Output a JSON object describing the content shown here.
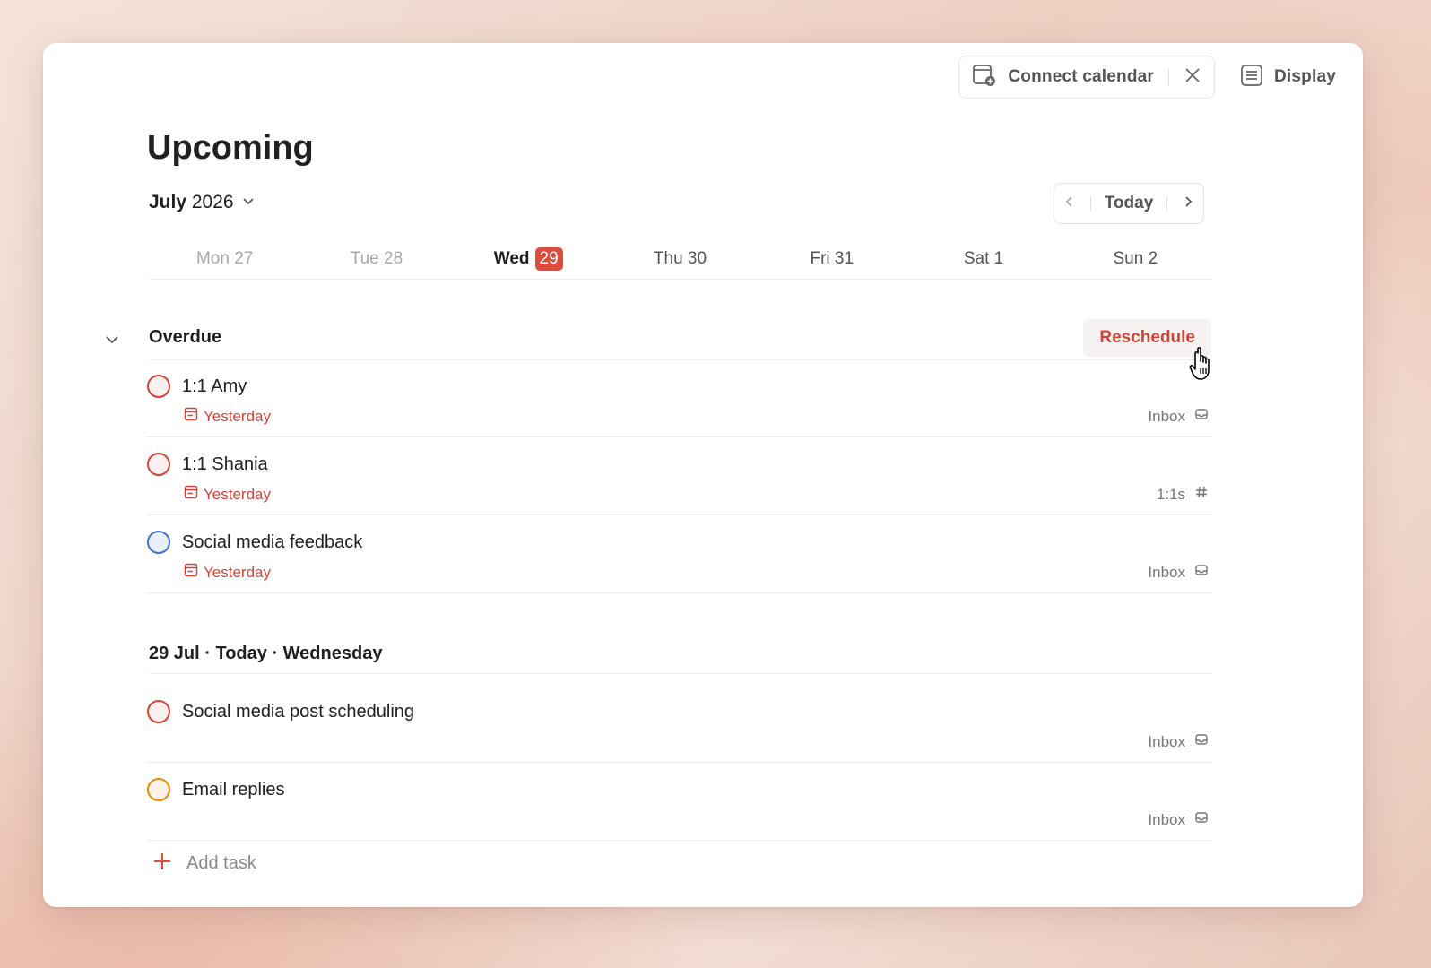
{
  "header": {
    "connect_calendar_label": "Connect calendar",
    "display_label": "Display"
  },
  "page": {
    "title": "Upcoming",
    "month": "July",
    "year": "2026"
  },
  "nav": {
    "today_label": "Today"
  },
  "week": [
    {
      "label": "Mon 27",
      "state": "past"
    },
    {
      "label": "Tue 28",
      "state": "past"
    },
    {
      "label": "Wed",
      "badge": "29",
      "state": "today"
    },
    {
      "label": "Thu 30",
      "state": "future"
    },
    {
      "label": "Fri 31",
      "state": "future"
    },
    {
      "label": "Sat 1",
      "state": "future"
    },
    {
      "label": "Sun 2",
      "state": "future"
    }
  ],
  "overdue": {
    "title": "Overdue",
    "reschedule_label": "Reschedule",
    "tasks": [
      {
        "name": "1:1 Amy",
        "due": "Yesterday",
        "project": "Inbox",
        "project_icon": "inbox-icon",
        "priority_color": "#d1453b"
      },
      {
        "name": "1:1 Shania",
        "due": "Yesterday",
        "project": "1:1s",
        "project_icon": "hash-icon",
        "priority_color": "#d1453b"
      },
      {
        "name": "Social media feedback",
        "due": "Yesterday",
        "project": "Inbox",
        "project_icon": "inbox-icon",
        "priority_color": "#4073d6"
      }
    ]
  },
  "today_section": {
    "title": "29 Jul · Today · Wednesday",
    "tasks": [
      {
        "name": "Social media post scheduling",
        "project": "Inbox",
        "project_icon": "inbox-icon",
        "priority_color": "#d1453b"
      },
      {
        "name": "Email replies",
        "project": "Inbox",
        "project_icon": "inbox-icon",
        "priority_color": "#eb8909"
      }
    ]
  },
  "add_task_label": "Add task",
  "colors": {
    "accent": "#dc4c3e",
    "text": "#202020",
    "muted": "#777777"
  }
}
